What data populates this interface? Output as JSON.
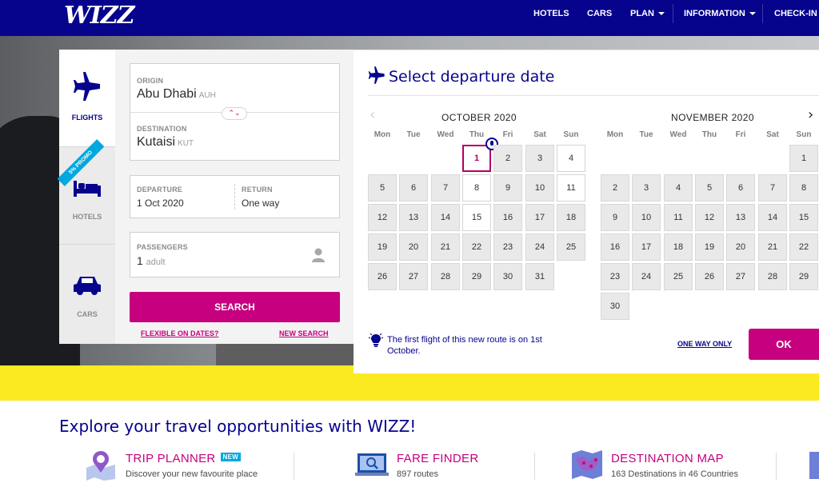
{
  "header": {
    "logo": "WIZZ",
    "nav": [
      {
        "label": "HOTELS",
        "has_caret": false
      },
      {
        "label": "CARS",
        "has_caret": false
      },
      {
        "label": "PLAN",
        "has_caret": true
      },
      {
        "label": "INFORMATION",
        "has_caret": true
      },
      {
        "label": "CHECK-IN &",
        "has_caret": false
      }
    ]
  },
  "side_tabs": {
    "flights": "FLIGHTS",
    "hotels": "HOTELS",
    "cars": "CARS",
    "promo_badge": "5% PROMO"
  },
  "search_form": {
    "origin_label": "ORIGIN",
    "origin_city": "Abu Dhabi",
    "origin_code": "AUH",
    "destination_label": "DESTINATION",
    "destination_city": "Kutaisi",
    "destination_code": "KUT",
    "departure_label": "DEPARTURE",
    "departure_value": "1 Oct 2020",
    "return_label": "RETURN",
    "return_value": "One way",
    "passengers_label": "PASSENGERS",
    "passengers_count": "1",
    "passengers_unit": "adult",
    "search_button": "SEARCH",
    "flexible_link": "FLEXIBLE ON DATES?",
    "new_search_link": "NEW SEARCH"
  },
  "date_picker": {
    "title": "Select departure date",
    "weekdays": [
      "Mon",
      "Tue",
      "Wed",
      "Thu",
      "Fri",
      "Sat",
      "Sun"
    ],
    "months": [
      {
        "title": "OCTOBER 2020",
        "first_weekday_index": 3,
        "days_in_month": 31,
        "available_days": [
          1,
          4,
          8,
          11,
          15
        ],
        "selected_day": 1
      },
      {
        "title": "NOVEMBER 2020",
        "first_weekday_index": 6,
        "days_in_month": 30,
        "available_days": [],
        "selected_day": null
      }
    ],
    "note": "The first flight of this new route is on 1st October.",
    "one_way_link": "ONE WAY ONLY",
    "ok_button": "OK",
    "colors": {
      "selected": "#b4005f",
      "brand": "#06038d",
      "accent": "#c6007e"
    }
  },
  "explore": {
    "title": "Explore your travel opportunities with WIZZ!",
    "features": [
      {
        "title": "TRIP PLANNER",
        "badge": "NEW",
        "subtitle": "Discover your new favourite place",
        "icon": "map-pin-icon"
      },
      {
        "title": "FARE FINDER",
        "badge": "",
        "subtitle": "897 routes",
        "icon": "laptop-search-icon"
      },
      {
        "title": "DESTINATION MAP",
        "badge": "",
        "subtitle": "163 Destinations in 46 Countries",
        "icon": "europe-map-icon"
      }
    ]
  }
}
